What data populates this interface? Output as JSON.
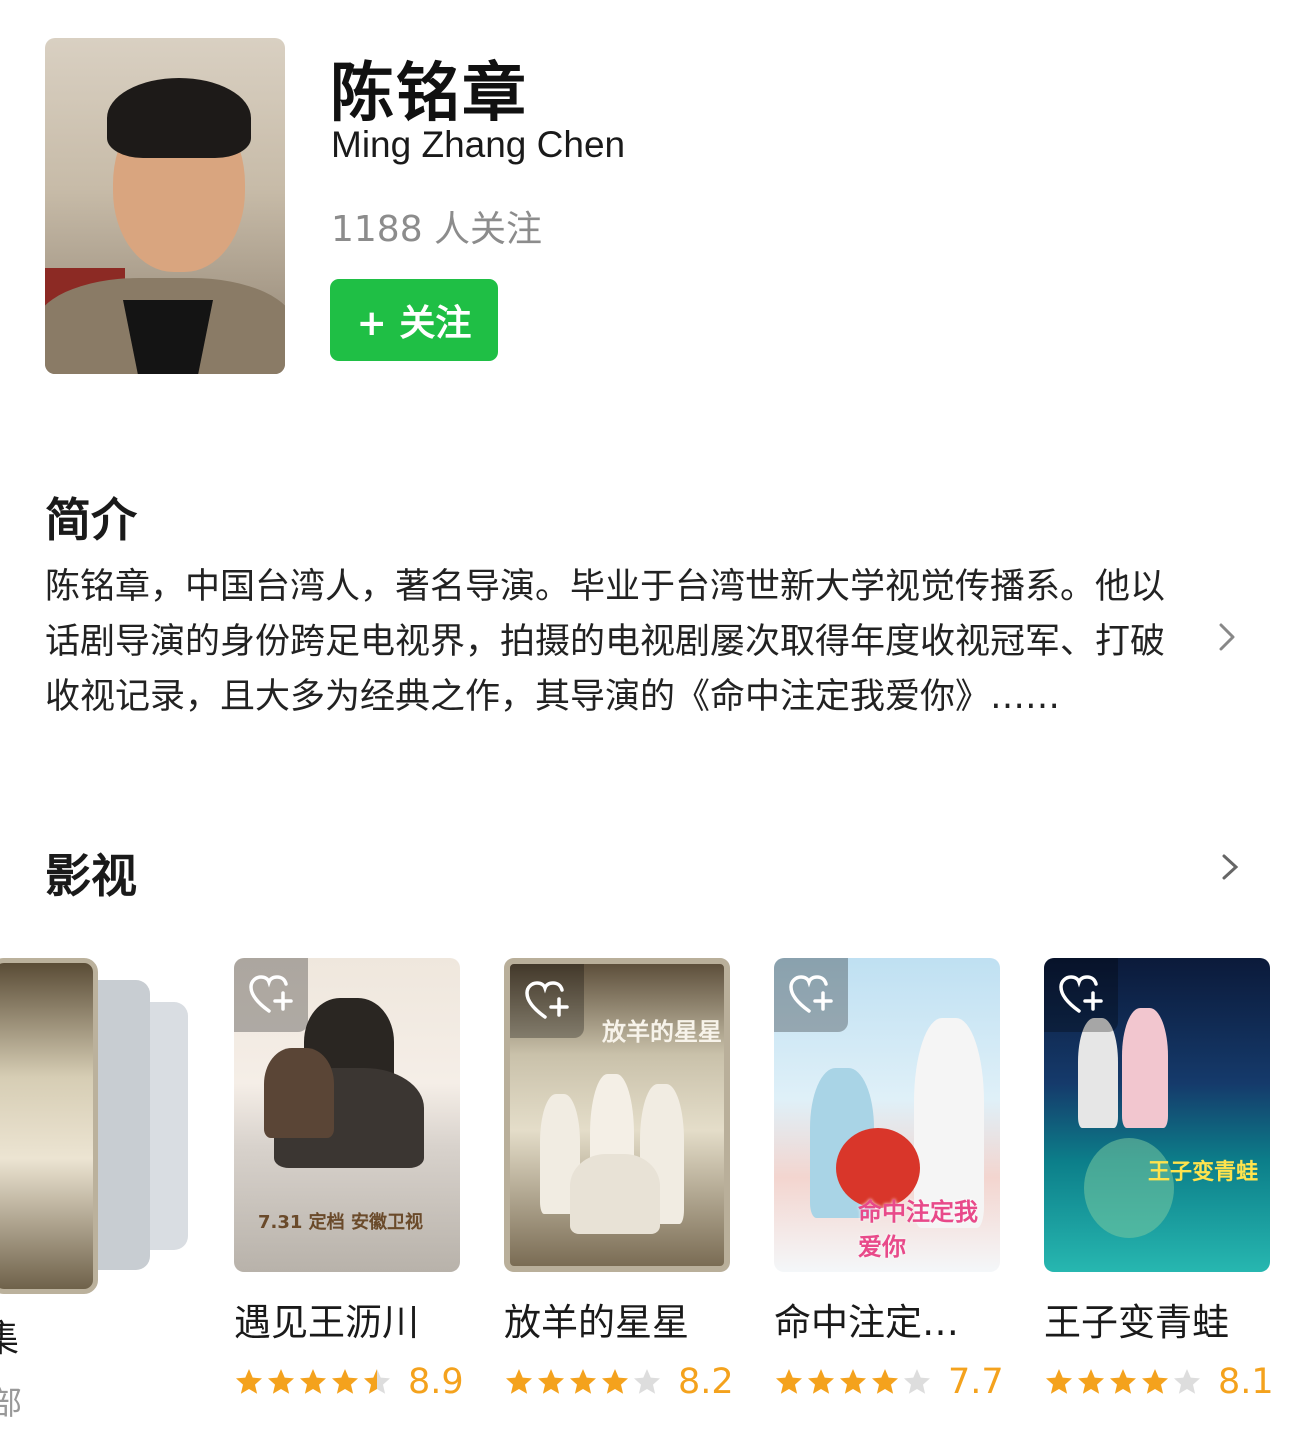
{
  "profile": {
    "name_zh": "陈铭章",
    "name_en": "Ming Zhang Chen",
    "followers": "1188 人关注",
    "follow_button": "+ 关注"
  },
  "intro": {
    "title": "简介",
    "text": "陈铭章，中国台湾人，著名导演。毕业于台湾世新大学视觉传播系。他以话剧导演的身份跨足电视界，拍摄的电视剧屡次取得年度收视冠军、打破收视记录，且大多为经典之作，其导演的《命中注定我爱你》……"
  },
  "films": {
    "title": "影视",
    "partial_left": {
      "title_fragment": "集",
      "sub_fragment": "部"
    },
    "items": [
      {
        "title": "遇见王沥川",
        "score": "8.9",
        "stars": 4.5,
        "poster_text": "7.31 定档 安徽卫视"
      },
      {
        "title": "放羊的星星",
        "score": "8.2",
        "stars": 4,
        "poster_text": "放羊的星星"
      },
      {
        "title": "命中注定…",
        "score": "7.7",
        "stars": 4,
        "poster_text": "命中注定我爱你"
      },
      {
        "title": "王子变青蛙",
        "score": "8.1",
        "stars": 4,
        "poster_text": "王子变青蛙"
      }
    ]
  },
  "colors": {
    "accent_green": "#1fbf45",
    "star_orange": "#f4a21d",
    "star_gray": "#dddddd"
  }
}
